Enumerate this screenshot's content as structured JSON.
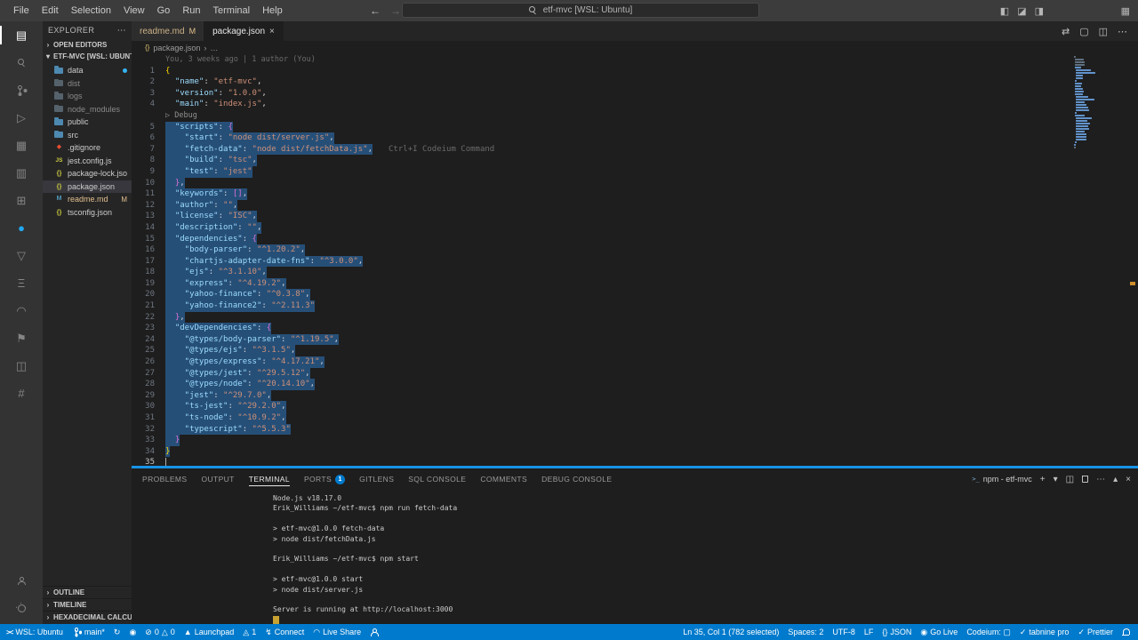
{
  "title_bar": {
    "menus": [
      "File",
      "Edit",
      "Selection",
      "View",
      "Go",
      "Run",
      "Terminal",
      "Help"
    ],
    "search_text": "etf-mvc [WSL: Ubuntu]",
    "back_arrow": "←",
    "forward_arrow": "→",
    "right_icons": [
      {
        "name": "toggle-primary-sidebar-icon",
        "glyph": "◧"
      },
      {
        "name": "toggle-panel-icon",
        "glyph": "◪"
      },
      {
        "name": "toggle-secondary-sidebar-icon",
        "glyph": "◨"
      }
    ],
    "customize_layout_glyph": "▦"
  },
  "activity_bar": {
    "top": [
      {
        "name": "explorer",
        "glyph": "▤",
        "active": true
      },
      {
        "name": "search",
        "cls": "i-mag"
      },
      {
        "name": "source-control",
        "cls": "i-branch-lg"
      },
      {
        "name": "run-and-debug",
        "glyph": "▷"
      },
      {
        "name": "docker",
        "glyph": "▦"
      },
      {
        "name": "remote-explorer",
        "glyph": "▥"
      },
      {
        "name": "extensions",
        "glyph": "⊞"
      },
      {
        "name": "codeium",
        "glyph": "●",
        "color": "#22a7f2"
      },
      {
        "name": "testing",
        "glyph": "▽"
      },
      {
        "name": "database",
        "glyph": "Ξ"
      },
      {
        "name": "live-share",
        "glyph": "◠"
      },
      {
        "name": "bookmarks",
        "glyph": "⚑"
      },
      {
        "name": "sql-console",
        "glyph": "◫"
      },
      {
        "name": "hex-calculator",
        "glyph": "#"
      }
    ],
    "bottom": [
      {
        "name": "accounts",
        "cls": "i-person"
      },
      {
        "name": "settings",
        "cls": "i-gear"
      }
    ]
  },
  "sidebar": {
    "title": "EXPLORER",
    "title_more": "⋯",
    "open_editors_label": "OPEN EDITORS",
    "workspace_label": "ETF-MVC [WSL: UBUNTU]",
    "files": [
      {
        "label": "data",
        "icon": "folder",
        "dot": true
      },
      {
        "label": "dist",
        "icon": "folder",
        "dim": true
      },
      {
        "label": "logs",
        "icon": "folder",
        "dim": true
      },
      {
        "label": "node_modules",
        "icon": "folder",
        "dim": true
      },
      {
        "label": "public",
        "icon": "folder"
      },
      {
        "label": "src",
        "icon": "folder"
      },
      {
        "label": ".gitignore",
        "icon": "git"
      },
      {
        "label": "jest.config.js",
        "icon": "js"
      },
      {
        "label": "package-lock.json",
        "icon": "json"
      },
      {
        "label": "package.json",
        "icon": "json",
        "selected": true
      },
      {
        "label": "readme.md",
        "icon": "md",
        "badge": "M",
        "modified": true
      },
      {
        "label": "tsconfig.json",
        "icon": "json"
      }
    ],
    "bottom_sections": [
      "OUTLINE",
      "TIMELINE",
      "HEXADECIMAL CALCULAT..."
    ]
  },
  "editor": {
    "tabs": [
      {
        "label": "readme.md",
        "badge": "M",
        "modified": true
      },
      {
        "label": "package.json",
        "active": true,
        "close": "×"
      }
    ],
    "actions": [
      {
        "name": "open-changes-icon",
        "glyph": "⇄"
      },
      {
        "name": "toggle-blame-icon",
        "glyph": "▢"
      },
      {
        "name": "split-editor-icon",
        "glyph": "◫"
      },
      {
        "name": "more-actions-icon",
        "glyph": "⋯"
      }
    ],
    "breadcrumb": {
      "icon": "{}",
      "file": "package.json",
      "sep": "›",
      "tail": "…"
    },
    "rows": [
      {
        "blame": "You, 3 weeks ago | 1 author (You)"
      },
      {
        "n": 1,
        "t": [
          [
            "b1",
            "{"
          ]
        ]
      },
      {
        "n": 2,
        "t": [
          [
            "k",
            "  \"name\""
          ],
          [
            "p",
            ": "
          ],
          [
            "s",
            "\"etf-mvc\""
          ],
          [
            "p",
            ","
          ]
        ]
      },
      {
        "n": 3,
        "t": [
          [
            "k",
            "  \"version\""
          ],
          [
            "p",
            ": "
          ],
          [
            "s",
            "\"1.0.0\""
          ],
          [
            "p",
            ","
          ]
        ]
      },
      {
        "n": 4,
        "t": [
          [
            "k",
            "  \"main\""
          ],
          [
            "p",
            ": "
          ],
          [
            "s",
            "\"index.js\""
          ],
          [
            "p",
            ","
          ]
        ]
      },
      {
        "lens": "▷ Debug"
      },
      {
        "n": 5,
        "sel": true,
        "t": [
          [
            "k",
            "  \"scripts\""
          ],
          [
            "p",
            ": "
          ],
          [
            "b2",
            "{"
          ]
        ]
      },
      {
        "n": 6,
        "sel": true,
        "t": [
          [
            "k",
            "    \"start\""
          ],
          [
            "p",
            ": "
          ],
          [
            "s",
            "\"node dist/server.js\""
          ],
          [
            "p",
            ","
          ]
        ]
      },
      {
        "n": 7,
        "sel": true,
        "hint": "Ctrl+I Codeium Command",
        "t": [
          [
            "k",
            "    \"fetch-data\""
          ],
          [
            "p",
            ": "
          ],
          [
            "s",
            "\"node dist/fetchData.js\""
          ],
          [
            "p",
            ","
          ]
        ]
      },
      {
        "n": 8,
        "sel": true,
        "t": [
          [
            "k",
            "    \"build\""
          ],
          [
            "p",
            ": "
          ],
          [
            "s",
            "\"tsc\""
          ],
          [
            "p",
            ","
          ]
        ]
      },
      {
        "n": 9,
        "sel": true,
        "t": [
          [
            "k",
            "    \"test\""
          ],
          [
            "p",
            ": "
          ],
          [
            "s",
            "\"jest\""
          ]
        ]
      },
      {
        "n": 10,
        "sel": true,
        "t": [
          [
            "p",
            "  "
          ],
          [
            "b2",
            "}"
          ],
          [
            "p",
            ","
          ]
        ]
      },
      {
        "n": 11,
        "sel": true,
        "t": [
          [
            "k",
            "  \"keywords\""
          ],
          [
            "p",
            ": "
          ],
          [
            "b2",
            "[]"
          ],
          [
            "p",
            ","
          ]
        ]
      },
      {
        "n": 12,
        "sel": true,
        "t": [
          [
            "k",
            "  \"author\""
          ],
          [
            "p",
            ": "
          ],
          [
            "s",
            "\"\""
          ],
          [
            "p",
            ","
          ]
        ]
      },
      {
        "n": 13,
        "sel": true,
        "t": [
          [
            "k",
            "  \"license\""
          ],
          [
            "p",
            ": "
          ],
          [
            "s",
            "\"ISC\""
          ],
          [
            "p",
            ","
          ]
        ]
      },
      {
        "n": 14,
        "sel": true,
        "t": [
          [
            "k",
            "  \"description\""
          ],
          [
            "p",
            ": "
          ],
          [
            "s",
            "\"\""
          ],
          [
            "p",
            ","
          ]
        ]
      },
      {
        "n": 15,
        "sel": true,
        "t": [
          [
            "k",
            "  \"dependencies\""
          ],
          [
            "p",
            ": "
          ],
          [
            "b2",
            "{"
          ]
        ]
      },
      {
        "n": 16,
        "sel": true,
        "t": [
          [
            "k",
            "    \"body-parser\""
          ],
          [
            "p",
            ": "
          ],
          [
            "s",
            "\"^1.20.2\""
          ],
          [
            "p",
            ","
          ]
        ]
      },
      {
        "n": 17,
        "sel": true,
        "t": [
          [
            "k",
            "    \"chartjs-adapter-date-fns\""
          ],
          [
            "p",
            ": "
          ],
          [
            "s",
            "\"^3.0.0\""
          ],
          [
            "p",
            ","
          ]
        ]
      },
      {
        "n": 18,
        "sel": true,
        "t": [
          [
            "k",
            "    \"ejs\""
          ],
          [
            "p",
            ": "
          ],
          [
            "s",
            "\"^3.1.10\""
          ],
          [
            "p",
            ","
          ]
        ]
      },
      {
        "n": 19,
        "sel": true,
        "t": [
          [
            "k",
            "    \"express\""
          ],
          [
            "p",
            ": "
          ],
          [
            "s",
            "\"^4.19.2\""
          ],
          [
            "p",
            ","
          ]
        ]
      },
      {
        "n": 20,
        "sel": true,
        "t": [
          [
            "k",
            "    \"yahoo-finance\""
          ],
          [
            "p",
            ": "
          ],
          [
            "s",
            "\"^0.3.8\""
          ],
          [
            "p",
            ","
          ]
        ]
      },
      {
        "n": 21,
        "sel": true,
        "t": [
          [
            "k",
            "    \"yahoo-finance2\""
          ],
          [
            "p",
            ": "
          ],
          [
            "s",
            "\"^2.11.3\""
          ]
        ]
      },
      {
        "n": 22,
        "sel": true,
        "t": [
          [
            "p",
            "  "
          ],
          [
            "b2",
            "}"
          ],
          [
            "p",
            ","
          ]
        ]
      },
      {
        "n": 23,
        "sel": true,
        "t": [
          [
            "k",
            "  \"devDependencies\""
          ],
          [
            "p",
            ": "
          ],
          [
            "b2",
            "{"
          ]
        ]
      },
      {
        "n": 24,
        "sel": true,
        "t": [
          [
            "k",
            "    \"@types/body-parser\""
          ],
          [
            "p",
            ": "
          ],
          [
            "s",
            "\"^1.19.5\""
          ],
          [
            "p",
            ","
          ]
        ]
      },
      {
        "n": 25,
        "sel": true,
        "t": [
          [
            "k",
            "    \"@types/ejs\""
          ],
          [
            "p",
            ": "
          ],
          [
            "s",
            "\"^3.1.5\""
          ],
          [
            "p",
            ","
          ]
        ]
      },
      {
        "n": 26,
        "sel": true,
        "t": [
          [
            "k",
            "    \"@types/express\""
          ],
          [
            "p",
            ": "
          ],
          [
            "s",
            "\"^4.17.21\""
          ],
          [
            "p",
            ","
          ]
        ]
      },
      {
        "n": 27,
        "sel": true,
        "t": [
          [
            "k",
            "    \"@types/jest\""
          ],
          [
            "p",
            ": "
          ],
          [
            "s",
            "\"^29.5.12\""
          ],
          [
            "p",
            ","
          ]
        ]
      },
      {
        "n": 28,
        "sel": true,
        "t": [
          [
            "k",
            "    \"@types/node\""
          ],
          [
            "p",
            ": "
          ],
          [
            "s",
            "\"^20.14.10\""
          ],
          [
            "p",
            ","
          ]
        ]
      },
      {
        "n": 29,
        "sel": true,
        "t": [
          [
            "k",
            "    \"jest\""
          ],
          [
            "p",
            ": "
          ],
          [
            "s",
            "\"^29.7.0\""
          ],
          [
            "p",
            ","
          ]
        ]
      },
      {
        "n": 30,
        "sel": true,
        "t": [
          [
            "k",
            "    \"ts-jest\""
          ],
          [
            "p",
            ": "
          ],
          [
            "s",
            "\"^29.2.0\""
          ],
          [
            "p",
            ","
          ]
        ]
      },
      {
        "n": 31,
        "sel": true,
        "t": [
          [
            "k",
            "    \"ts-node\""
          ],
          [
            "p",
            ": "
          ],
          [
            "s",
            "\"^10.9.2\""
          ],
          [
            "p",
            ","
          ]
        ]
      },
      {
        "n": 32,
        "sel": true,
        "t": [
          [
            "k",
            "    \"typescript\""
          ],
          [
            "p",
            ": "
          ],
          [
            "s",
            "\"^5.5.3\""
          ]
        ]
      },
      {
        "n": 33,
        "sel": true,
        "t": [
          [
            "p",
            "  "
          ],
          [
            "b2",
            "}"
          ]
        ]
      },
      {
        "n": 34,
        "sel": true,
        "t": [
          [
            "b1",
            "}"
          ]
        ]
      },
      {
        "n": 35,
        "cursor": true,
        "t": []
      }
    ]
  },
  "panel": {
    "tabs": [
      {
        "label": "PROBLEMS"
      },
      {
        "label": "OUTPUT"
      },
      {
        "label": "TERMINAL",
        "active": true
      },
      {
        "label": "PORTS",
        "badge": "1"
      },
      {
        "label": "GITLENS"
      },
      {
        "label": "SQL CONSOLE"
      },
      {
        "label": "COMMENTS"
      },
      {
        "label": "DEBUG CONSOLE"
      }
    ],
    "terminal_label": "npm - etf-mvc",
    "actions": [
      {
        "name": "new-terminal-icon",
        "glyph": "+"
      },
      {
        "name": "terminal-picker-chevron-icon",
        "glyph": "▾"
      },
      {
        "name": "split-terminal-icon",
        "glyph": "◫"
      },
      {
        "name": "kill-terminal-icon",
        "cls": "i-trash"
      },
      {
        "name": "panel-more-icon",
        "glyph": "⋯"
      },
      {
        "name": "maximize-panel-icon",
        "glyph": "▴"
      },
      {
        "name": "close-panel-icon",
        "glyph": "×"
      }
    ],
    "terminal_lines": [
      {
        "text": "Node.js v18.17.0"
      },
      {
        "prompt": true,
        "dot": true,
        "user": "Erik_Williams",
        "path": "~/etf-mvc",
        "cmd": "npm run fetch-data"
      },
      {
        "text": ""
      },
      {
        "text": "> etf-mvc@1.0.0 fetch-data"
      },
      {
        "text": "> node dist/fetchData.js"
      },
      {
        "text": ""
      },
      {
        "prompt": true,
        "user": "Erik_Williams",
        "path": "~/etf-mvc",
        "cmd": "npm start"
      },
      {
        "text": ""
      },
      {
        "text": "> etf-mvc@1.0.0 start"
      },
      {
        "text": "> node dist/server.js"
      },
      {
        "text": ""
      },
      {
        "text": "Server is running at http://localhost:3000"
      },
      {
        "cursor": true
      }
    ]
  },
  "status_bar": {
    "left": [
      {
        "name": "remote-indicator",
        "icon_glyph": "><",
        "rem": true,
        "label": "WSL: Ubuntu"
      },
      {
        "name": "git-branch",
        "icon_cls": "i-branch-sm",
        "label": "main*"
      },
      {
        "name": "git-sync",
        "icon_glyph": "↻"
      },
      {
        "name": "gitlens-blame-toggle",
        "icon_glyph": "◉"
      },
      {
        "name": "problems",
        "icon_glyph": "⊘",
        "label": "0",
        "icon2_glyph": "△",
        "label2": "0"
      },
      {
        "name": "gitlens-launchpad",
        "icon_glyph": "▲",
        "label": "Launchpad"
      },
      {
        "name": "forwarded-ports",
        "icon_glyph": "◬",
        "label": "1"
      },
      {
        "name": "sqltools-connect",
        "icon_glyph": "↯",
        "label": "Connect"
      },
      {
        "name": "live-share",
        "icon_glyph": "◠",
        "label": "Live Share"
      },
      {
        "name": "account-status",
        "icon_cls": "i-person"
      }
    ],
    "right": [
      {
        "name": "cursor-position",
        "label": "Ln 35, Col 1 (782 selected)"
      },
      {
        "name": "indentation",
        "label": "Spaces: 2"
      },
      {
        "name": "encoding",
        "label": "UTF-8"
      },
      {
        "name": "eol",
        "label": "LF"
      },
      {
        "name": "language-mode",
        "icon_glyph": "{}",
        "label": "JSON"
      },
      {
        "name": "go-live",
        "icon_glyph": "◉",
        "label": "Go Live"
      },
      {
        "name": "codeium-status",
        "label": "Codeium: ▢"
      },
      {
        "name": "tabnine",
        "icon_glyph": "✓",
        "label": "tabnine pro"
      },
      {
        "name": "prettier",
        "icon_glyph": "✓",
        "label": "Prettier"
      },
      {
        "name": "notifications",
        "icon_cls": "i-bell"
      }
    ]
  }
}
